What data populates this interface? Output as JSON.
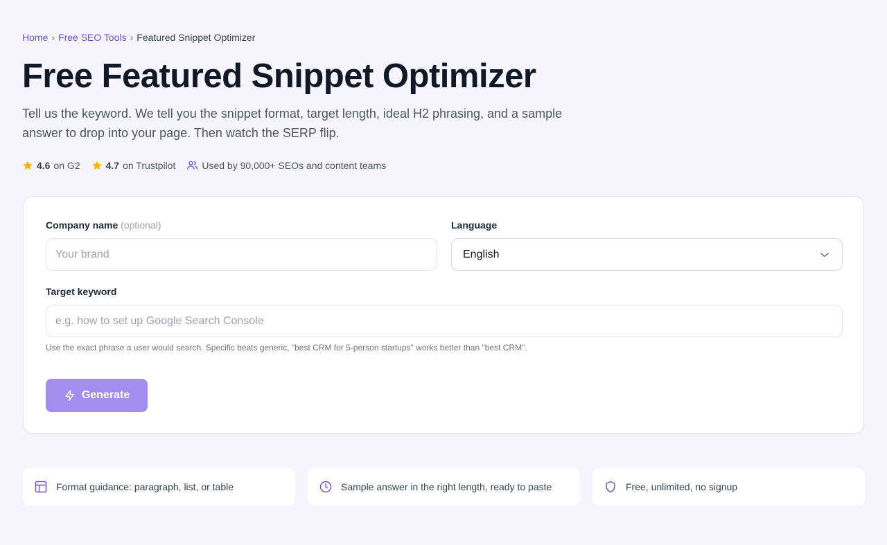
{
  "breadcrumb": {
    "home": "Home",
    "tools": "Free SEO Tools",
    "current": "Featured Snippet Optimizer",
    "separator": "›"
  },
  "hero": {
    "title": "Free Featured Snippet Optimizer",
    "subtitle": "Tell us the keyword. We tell you the snippet format, target length, ideal H2 phrasing, and a sample answer to drop into your page. Then watch the SERP flip."
  },
  "ratings": {
    "g2_score": "4.6",
    "g2_label": "on G2",
    "trustpilot_score": "4.7",
    "trustpilot_label": "on Trustpilot",
    "users": "Used by 90,000+ SEOs and content teams"
  },
  "form": {
    "company_label": "Company name",
    "company_optional": "(optional)",
    "company_placeholder": "Your brand",
    "language_label": "Language",
    "language_value": "English",
    "keyword_label": "Target keyword",
    "keyword_placeholder": "e.g. how to set up Google Search Console",
    "keyword_hint": "Use the exact phrase a user would search. Specific beats generic, \"best CRM for 5-person startups\" works better than \"best CRM\".",
    "generate_label": "Generate"
  },
  "features": [
    {
      "icon": "layout-icon",
      "text": "Format guidance: paragraph, list, or table"
    },
    {
      "icon": "clock-icon",
      "text": "Sample answer in the right length, ready to paste"
    },
    {
      "icon": "shield-icon",
      "text": "Free, unlimited, no signup"
    }
  ],
  "colors": {
    "accent": "#6d4fd8",
    "button": "#a48df0",
    "star": "#f5b40b",
    "background": "#f6f5fd"
  }
}
